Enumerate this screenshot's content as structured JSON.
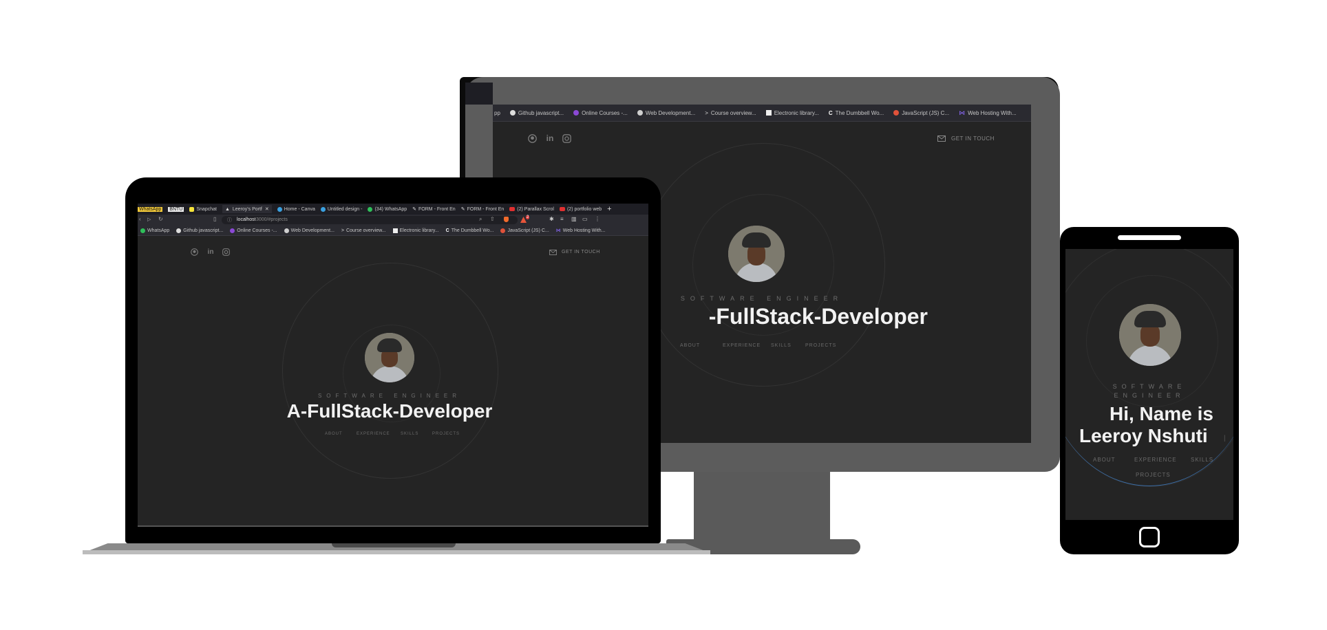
{
  "colors": {
    "site_bg": "#242424",
    "frame_dark": "#000000",
    "monitor_gray": "#5a5a5a",
    "hero_text": "#f2f2f2",
    "muted_text": "#6e6e6e",
    "accent_ring": "#3b6ea8"
  },
  "laptop": {
    "tabs": [
      "WhatsApp",
      "BNTU",
      "Snapchat",
      "Leeroy's Portf",
      "Home - Canva",
      "Untitled design -",
      "(34) WhatsApp",
      "FORM - Front En",
      "FORM - Front En",
      "(2) Parallax Scrol",
      "(2) portfolio web"
    ],
    "active_tab_index": 3,
    "address_host": "localhost",
    "address_path": ":3000/#projects",
    "bookmarks": [
      "WhatsApp",
      "Github javascript...",
      "Online Courses -...",
      "Web Development...",
      "Course overview...",
      "Electronic library...",
      "The Dumbbell Wo...",
      "JavaScript (JS) C...",
      "Web Hosting With..."
    ],
    "notif_count": "2"
  },
  "monitor": {
    "bookmarks": [
      "pp",
      "Github javascript...",
      "Online Courses -...",
      "Web Development...",
      "Course overview...",
      "Electronic library...",
      "The Dumbbell Wo...",
      "JavaScript (JS) C...",
      "Web Hosting With..."
    ]
  },
  "site": {
    "social_icons": [
      "github-icon",
      "linkedin-icon",
      "instagram-icon"
    ],
    "get_in_touch": "GET IN TOUCH",
    "role": "SOFTWARE ENGINEER",
    "role_tablet_line1": "SOFTWARE",
    "role_tablet_line2": "ENGINEER",
    "headline": "A-FullStack-Developer",
    "headline_monitor": "-FullStack-Developer",
    "greeting_line1": "Hi, Name is",
    "greeting_line2": "Leeroy Nshuti",
    "cursor": "|",
    "nav": [
      "ABOUT",
      "EXPERIENCE",
      "SKILLS",
      "PROJECTS"
    ]
  }
}
